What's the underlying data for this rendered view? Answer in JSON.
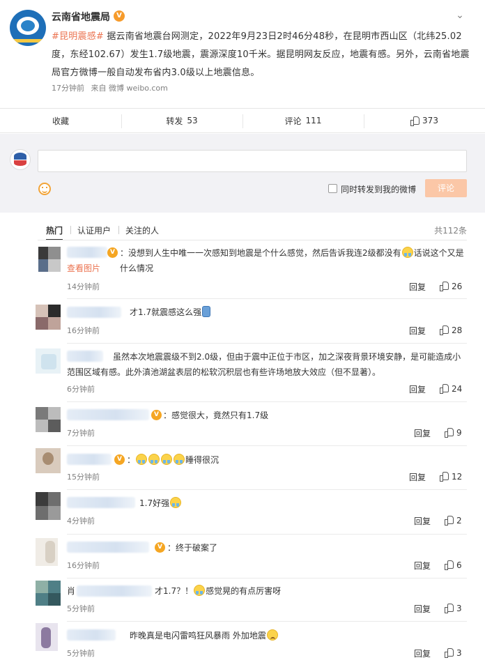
{
  "post": {
    "author": "云南省地震局",
    "verified_icon": "verified-badge-icon",
    "hashtag": "#昆明震感#",
    "text": " 据云南省地震台网测定，2022年9月23日2时46分48秒，在昆明市西山区（北纬25.02度，东经102.67）发生1.7级地震，震源深度10千米。据昆明网友反应，地震有感。另外，云南省地震局官方微博一般自动发布省内3.0级以上地震信息。",
    "time": "17分钟前",
    "source": "来自 微博 weibo.com",
    "menu_icon": "chevron-down-icon"
  },
  "actions": {
    "favorite": "收藏",
    "repost_label": "转发",
    "repost_count": "53",
    "comment_label": "评论",
    "comment_count": "111",
    "like_count": "373"
  },
  "compose": {
    "placeholder": "",
    "repost_option": "同时转发到我的微博",
    "submit": "评论"
  },
  "tabs": {
    "hot": "热门",
    "verified": "认证用户",
    "following": "关注的人",
    "total": "共112条"
  },
  "comments": [
    {
      "text_a": "：没想到人生中唯一一次感知到地震是个什么感觉，然后告诉我连2级都没有",
      "text_b": "话说这个又是什么情况",
      "link": "查看图片",
      "time": "14分钟前",
      "reply": "回复",
      "likes": "26"
    },
    {
      "text": "才1.7就震感这么强",
      "time": "16分钟前",
      "reply": "回复",
      "likes": "28"
    },
    {
      "text": "虽然本次地震震级不到2.0级，但由于震中正位于市区，加之深夜背景环境安静，是可能造成小范围区域有感。此外滇池湖盆表层的松软沉积层也有些许场地放大效应（但不显著）。",
      "time": "6分钟前",
      "reply": "回复",
      "likes": "24"
    },
    {
      "text": "：感觉很大，竟然只有1.7级",
      "time": "7分钟前",
      "reply": "回复",
      "likes": "9"
    },
    {
      "text": "睡得很沉",
      "time": "15分钟前",
      "reply": "回复",
      "likes": "12"
    },
    {
      "text": "1.7好强",
      "time": "4分钟前",
      "reply": "回复",
      "likes": "2"
    },
    {
      "text": "：终于破案了",
      "time": "16分钟前",
      "reply": "回复",
      "likes": "6"
    },
    {
      "name": "肖",
      "text_a": "才1.7？！",
      "text_b": "感觉晃的有点厉害呀",
      "time": "5分钟前",
      "reply": "回复",
      "likes": "3"
    },
    {
      "text": "昨晚真是电闪雷鸣狂风暴雨 外加地震",
      "time": "5分钟前",
      "reply": "回复",
      "likes": "3"
    }
  ],
  "colors": {
    "accent": "#eb7350",
    "verified": "#f5a623",
    "submit_disabled": "#fbc7a7",
    "compose_bg": "#f2f2f5"
  }
}
